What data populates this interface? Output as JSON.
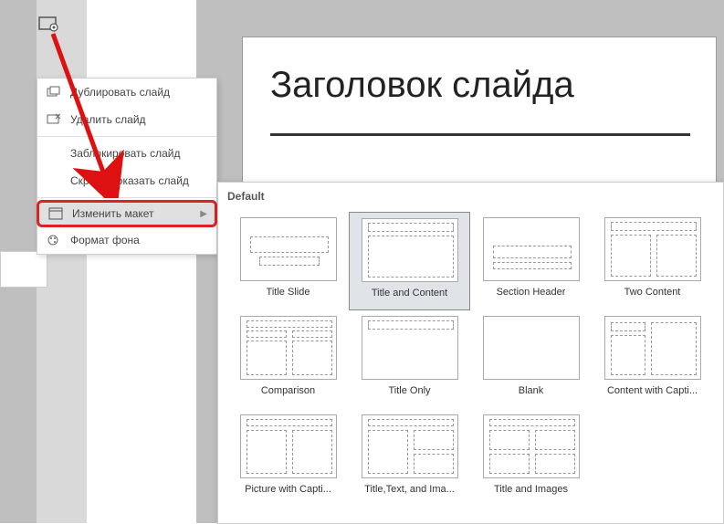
{
  "slide": {
    "title": "Заголовок слайда"
  },
  "context_menu": {
    "duplicate": "Дублировать слайд",
    "delete": "Удалить слайд",
    "lock": "Заблокировать слайд",
    "hide": "Скрыть/показать слайд",
    "change_layout": "Изменить макет",
    "background": "Формат фона"
  },
  "flyout": {
    "header": "Default",
    "layouts": [
      {
        "id": "title-slide",
        "label": "Title Slide"
      },
      {
        "id": "title-content",
        "label": "Title and Content"
      },
      {
        "id": "section-header",
        "label": "Section Header"
      },
      {
        "id": "two-content",
        "label": "Two Content"
      },
      {
        "id": "comparison",
        "label": "Comparison"
      },
      {
        "id": "title-only",
        "label": "Title Only"
      },
      {
        "id": "blank",
        "label": "Blank"
      },
      {
        "id": "content-caption",
        "label": "Content with Capti..."
      },
      {
        "id": "picture-caption",
        "label": "Picture with Capti..."
      },
      {
        "id": "title-text-images",
        "label": "Title,Text, and Ima..."
      },
      {
        "id": "title-images",
        "label": "Title and Images"
      }
    ]
  }
}
